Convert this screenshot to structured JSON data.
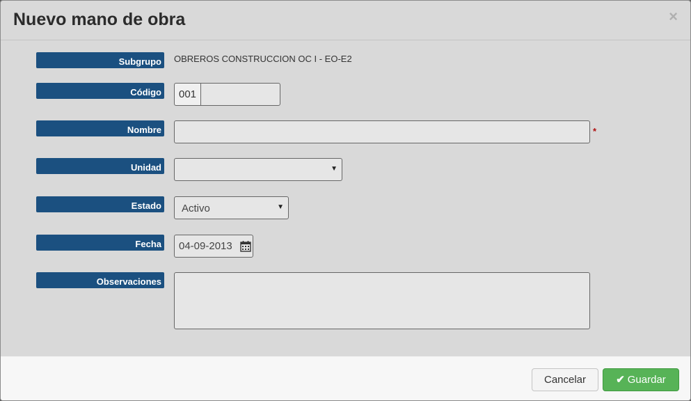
{
  "modal": {
    "title": "Nuevo mano de obra",
    "close_label": "×"
  },
  "form": {
    "subgrupo": {
      "label": "Subgrupo",
      "value": "OBREROS CONSTRUCCION OC I - EO-E2"
    },
    "codigo": {
      "label": "Código",
      "prefix": "001",
      "value": ""
    },
    "nombre": {
      "label": "Nombre",
      "value": "",
      "required_mark": "*"
    },
    "unidad": {
      "label": "Unidad",
      "selected": ""
    },
    "estado": {
      "label": "Estado",
      "selected": "Activo"
    },
    "fecha": {
      "label": "Fecha",
      "value": "04-09-2013"
    },
    "observaciones": {
      "label": "Observaciones",
      "value": ""
    }
  },
  "footer": {
    "cancel_label": "Cancelar",
    "save_label": "Guardar"
  },
  "colors": {
    "label_bg": "#1b5080",
    "save_bg": "#57b357",
    "required": "#b01010"
  },
  "icons": {
    "close": "close-icon",
    "calendar": "calendar-icon",
    "check": "check-icon",
    "dropdown": "chevron-down-icon"
  }
}
